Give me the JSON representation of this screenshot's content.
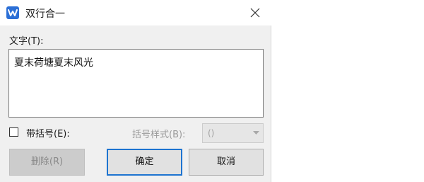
{
  "window": {
    "title": "双行合一",
    "accent_color": "#2b6fd6"
  },
  "icons": {
    "app": "wps-writer-icon",
    "close": "close-icon",
    "dropdown": "chevron-down-icon"
  },
  "form": {
    "text_label": "文字(T):",
    "text_value": "夏末荷塘夏末风光",
    "bracket_checkbox_label": "带括号(E):",
    "bracket_checked": false,
    "bracket_style_label": "括号样式(B):",
    "bracket_style_value": "()"
  },
  "buttons": {
    "delete_label": "删除(R)",
    "ok_label": "确定",
    "cancel_label": "取消"
  }
}
